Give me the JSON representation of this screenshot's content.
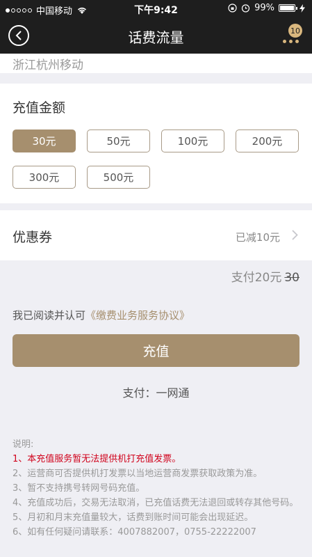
{
  "status_bar": {
    "carrier": "中国移动",
    "time": "下午9:42",
    "battery": "99%"
  },
  "nav": {
    "title": "话费流量",
    "badge": "10"
  },
  "region": "浙江杭州移动",
  "amount": {
    "title": "充值金额",
    "options": [
      "30元",
      "50元",
      "100元",
      "200元",
      "300元",
      "500元"
    ],
    "selected": "30元"
  },
  "coupon": {
    "label": "优惠券",
    "value": "已减10元"
  },
  "payment": {
    "prefix": "支付",
    "amount": "20元",
    "original": "30"
  },
  "agreement": {
    "text": "我已阅读并认可",
    "link": "《缴费业务服务协议》"
  },
  "charge_button": "充值",
  "pay_method": "支付：一网通",
  "notes": {
    "title": "说明:",
    "items": [
      "1、本充值服务暂无法提供机打充值发票。",
      "2、运营商可否提供机打发票以当地运营商发票获取政策为准。",
      "3、暂不支持携号转网号码充值。",
      "4、充值成功后，交易无法取消，已充值话费无法退回或转存其他号码。",
      "5、月初和月末充值量较大，话费到账时间可能会出现延迟。",
      "6、如有任何疑问请联系：4007882007，0755-22222007"
    ]
  },
  "colors": {
    "accent": "#a68f6e",
    "dark_bar": "#1e1e1e",
    "warning": "#d0021b"
  }
}
